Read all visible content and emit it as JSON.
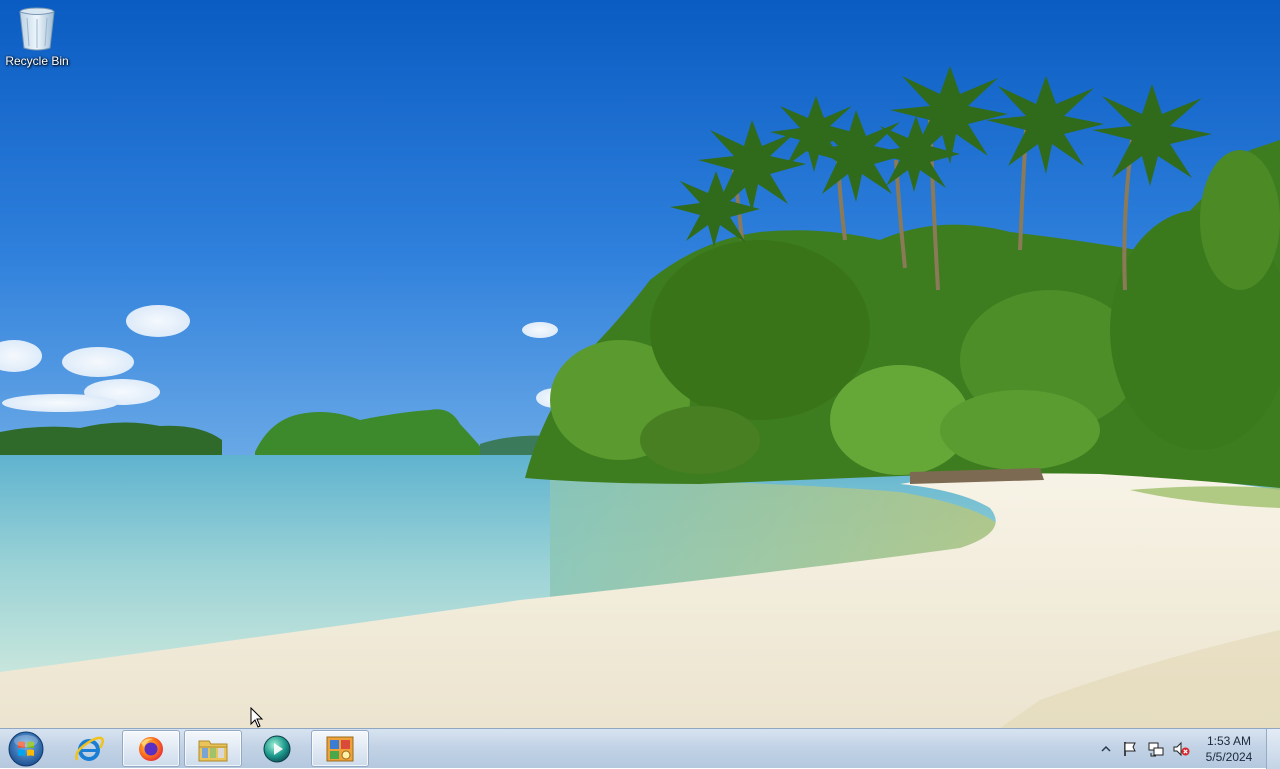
{
  "desktop": {
    "icons": [
      {
        "label": "Recycle Bin",
        "icon": "recycle-bin-icon"
      }
    ]
  },
  "taskbar": {
    "start": {
      "icon": "windows-start-orb-icon"
    },
    "pinned": [
      {
        "name": "Internet Explorer",
        "icon": "internet-explorer-icon",
        "active": false
      },
      {
        "name": "Firefox",
        "icon": "firefox-icon",
        "active": true
      },
      {
        "name": "Windows Explorer",
        "icon": "file-explorer-icon",
        "active": true
      },
      {
        "name": "Media Player",
        "icon": "media-player-icon",
        "active": false
      },
      {
        "name": "Control Panel",
        "icon": "control-panel-icon",
        "active": true
      }
    ],
    "tray": {
      "icons": [
        "show-hidden-icons-icon",
        "action-center-flag-icon",
        "network-icon",
        "volume-muted-icon"
      ]
    },
    "clock": {
      "time": "1:53 AM",
      "date": "5/5/2024"
    }
  },
  "colors": {
    "sky_top": "#0a5fc4",
    "sky_bottom": "#4f95e0",
    "sand": "#f2ede0",
    "foliage": "#3f7d1f",
    "water": "#9fd4d8",
    "taskbar": "#c3d3e6"
  }
}
